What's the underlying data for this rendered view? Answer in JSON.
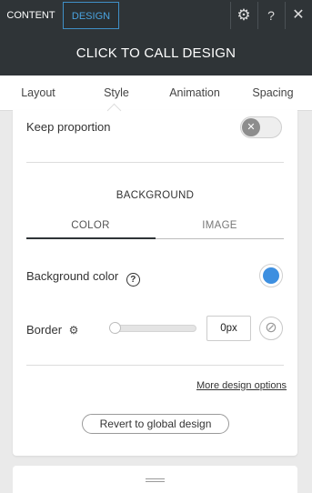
{
  "top_tabs": {
    "content": "CONTENT",
    "design": "DESIGN"
  },
  "top_icons": {
    "settings": "gear-icon",
    "help": "?",
    "close": "close-icon"
  },
  "header": {
    "title": "CLICK TO CALL DESIGN"
  },
  "sub_tabs": [
    {
      "label": "Layout"
    },
    {
      "label": "Style",
      "active": true
    },
    {
      "label": "Animation"
    },
    {
      "label": "Spacing"
    }
  ],
  "keep_proportion": {
    "label": "Keep proportion",
    "enabled": false
  },
  "background": {
    "title": "BACKGROUND",
    "tabs": [
      "COLOR",
      "IMAGE"
    ],
    "active_tab": "COLOR",
    "color_label": "Background color",
    "help_glyph": "?",
    "color_value": "#3d8fe0"
  },
  "border": {
    "label": "Border",
    "value": "0px",
    "slider_level": 0
  },
  "more_options": "More design options",
  "revert_button": "Revert to global design",
  "colors": {
    "dark_bg": "#2f3437",
    "accent": "#4aa3df"
  }
}
